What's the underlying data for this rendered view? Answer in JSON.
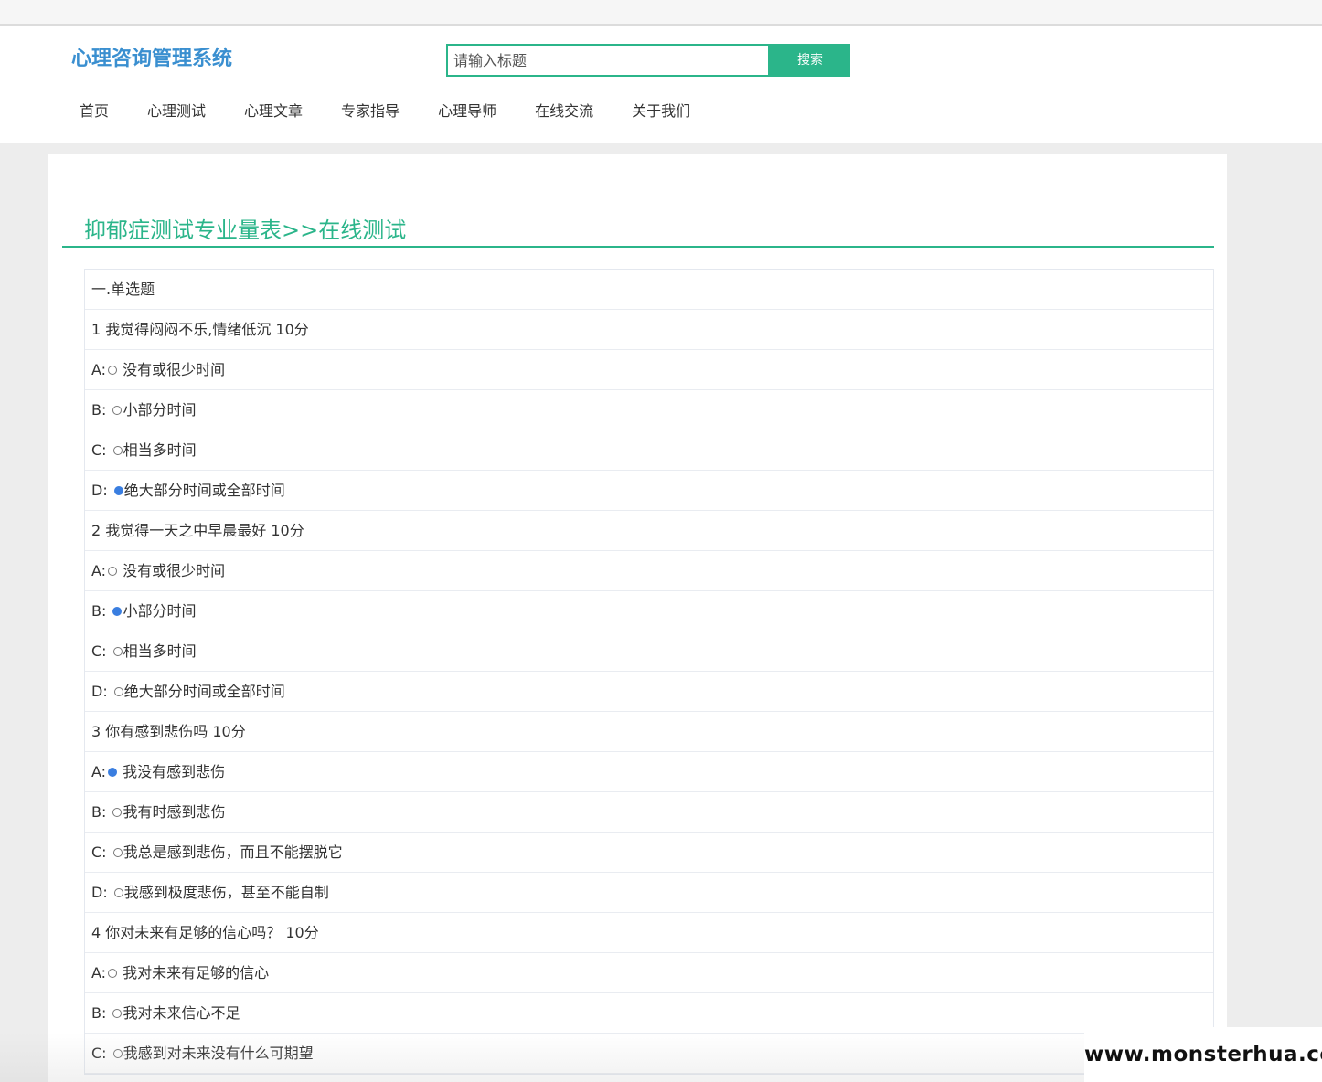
{
  "header": {
    "logo": "心理咨询管理系统",
    "search_placeholder": "请输入标题",
    "search_button": "搜索"
  },
  "nav": [
    "首页",
    "心理测试",
    "心理文章",
    "专家指导",
    "心理导师",
    "在线交流",
    "关于我们"
  ],
  "page_title": "抑郁症测试专业量表>>在线测试",
  "section_label": "一.单选题",
  "questions": [
    {
      "text": "1 我觉得闷闷不乐,情绪低沉 10分",
      "options": [
        {
          "prefix": "A:",
          "label": " 没有或很少时间",
          "checked": false
        },
        {
          "prefix": "B: ",
          "label": "小部分时间",
          "checked": false
        },
        {
          "prefix": "C: ",
          "label": "相当多时间",
          "checked": false
        },
        {
          "prefix": "D: ",
          "label": "绝大部分时间或全部时间",
          "checked": true
        }
      ]
    },
    {
      "text": "2 我觉得一天之中早晨最好 10分",
      "options": [
        {
          "prefix": "A:",
          "label": " 没有或很少时间",
          "checked": false
        },
        {
          "prefix": "B: ",
          "label": "小部分时间",
          "checked": true
        },
        {
          "prefix": "C: ",
          "label": "相当多时间",
          "checked": false
        },
        {
          "prefix": "D: ",
          "label": "绝大部分时间或全部时间",
          "checked": false
        }
      ]
    },
    {
      "text": "3 你有感到悲伤吗 10分",
      "options": [
        {
          "prefix": "A:",
          "label": " 我没有感到悲伤",
          "checked": true
        },
        {
          "prefix": "B: ",
          "label": "我有时感到悲伤",
          "checked": false
        },
        {
          "prefix": "C: ",
          "label": "我总是感到悲伤，而且不能摆脱它",
          "checked": false
        },
        {
          "prefix": "D: ",
          "label": "我感到极度悲伤，甚至不能自制",
          "checked": false
        }
      ]
    },
    {
      "text": "4 你对未来有足够的信心吗？ 10分",
      "options": [
        {
          "prefix": "A:",
          "label": " 我对未来有足够的信心",
          "checked": false
        },
        {
          "prefix": "B: ",
          "label": "我对未来信心不足",
          "checked": false
        },
        {
          "prefix": "C: ",
          "label": "我感到对未来没有什么可期望",
          "checked": false
        }
      ]
    }
  ],
  "watermark": "www.monsterhua.com"
}
